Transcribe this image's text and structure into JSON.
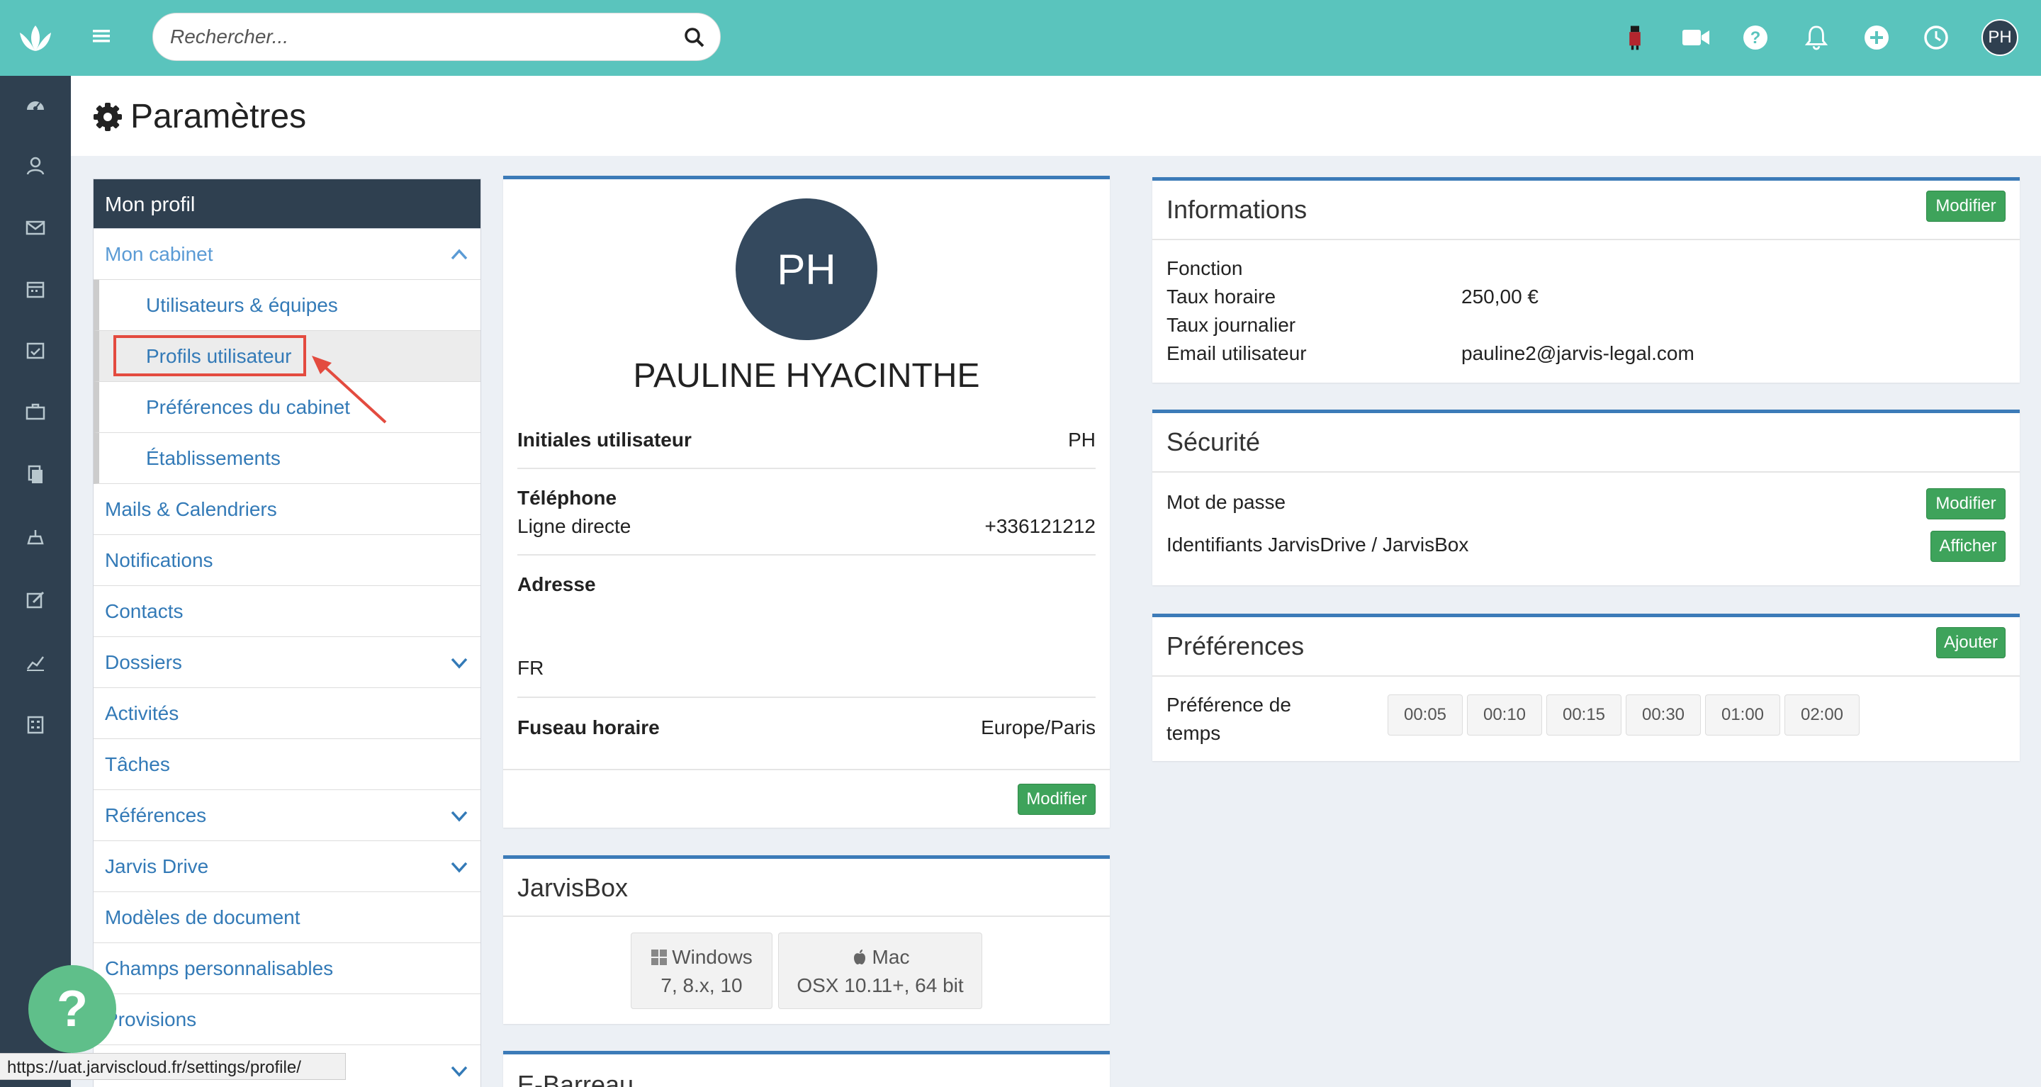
{
  "search": {
    "placeholder": "Rechercher..."
  },
  "header": {
    "avatar_initials": "PH"
  },
  "page": {
    "title": "Paramètres"
  },
  "menu": {
    "head": "Mon profil",
    "cabinet": "Mon cabinet",
    "sub": {
      "users": "Utilisateurs & équipes",
      "profiles": "Profils utilisateur",
      "prefs": "Préférences du cabinet",
      "estab": "Établissements"
    },
    "items": {
      "mails": "Mails & Calendriers",
      "notifications": "Notifications",
      "contacts": "Contacts",
      "dossiers": "Dossiers",
      "activites": "Activités",
      "taches": "Tâches",
      "references": "Références",
      "drive": "Jarvis Drive",
      "modeles": "Modèles de document",
      "champs": "Champs personnalisables",
      "provisions": "Provisions"
    }
  },
  "profile": {
    "initials": "PH",
    "name": "PAULINE HYACINTHE",
    "initials_label": "Initiales utilisateur",
    "initials_value": "PH",
    "phone_label": "Téléphone",
    "direct_label": "Ligne directe",
    "direct_value": "+336121212",
    "address_label": "Adresse",
    "address_country": "FR",
    "tz_label": "Fuseau horaire",
    "tz_value": "Europe/Paris",
    "modify": "Modifier"
  },
  "jarvisbox": {
    "title": "JarvisBox",
    "windows_label": "Windows",
    "windows_versions": "7, 8.x, 10",
    "mac_label": "Mac",
    "mac_versions": "OSX 10.11+, 64 bit"
  },
  "fbarreau": {
    "title": "E-Barreau"
  },
  "informations": {
    "title": "Informations",
    "modify": "Modifier",
    "fonction_label": "Fonction",
    "taux_h_label": "Taux horaire",
    "taux_h_value": "250,00 €",
    "taux_j_label": "Taux journalier",
    "email_label": "Email utilisateur",
    "email_value": "pauline2@jarvis-legal.com"
  },
  "securite": {
    "title": "Sécurité",
    "password_label": "Mot de passe",
    "password_btn": "Modifier",
    "ids_label": "Identifiants JarvisDrive / JarvisBox",
    "ids_btn": "Afficher"
  },
  "preferences": {
    "title": "Préférences",
    "add": "Ajouter",
    "time_label_1": "Préférence de",
    "time_label_2": "temps",
    "times": [
      "00:05",
      "00:10",
      "00:15",
      "00:30",
      "01:00",
      "02:00"
    ]
  },
  "help": {
    "symbol": "?"
  },
  "status": {
    "url": "https://uat.jarviscloud.fr/settings/profile/"
  }
}
